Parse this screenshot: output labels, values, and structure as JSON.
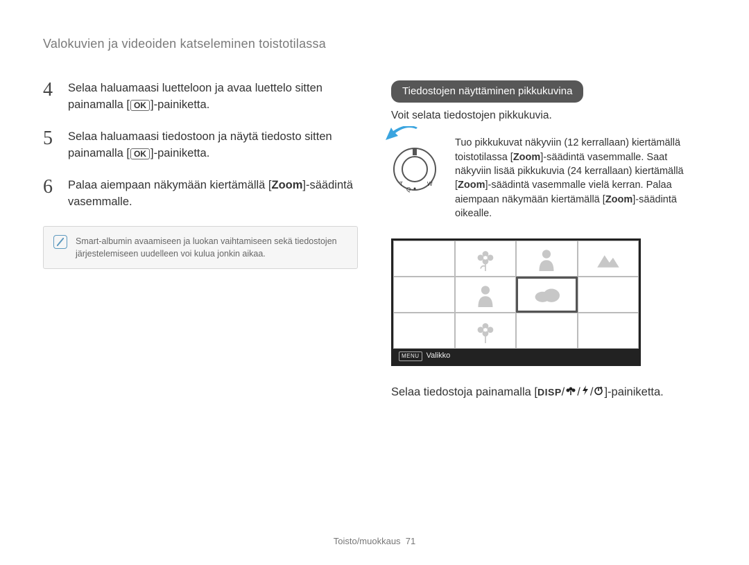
{
  "header": {
    "title": "Valokuvien ja videoiden katseleminen toistotilassa"
  },
  "steps": [
    {
      "num": "4",
      "pre": "Selaa haluamaasi luetteloon ja avaa luettelo sitten painamalla [",
      "ok": "OK",
      "post": "]-painiketta."
    },
    {
      "num": "5",
      "pre": "Selaa haluamaasi tiedostoon ja näytä tiedosto sitten painamalla [",
      "ok": "OK",
      "post": "]-painiketta."
    },
    {
      "num": "6",
      "pre": "Palaa aiempaan näkymään kiertämällä [",
      "bold": "Zoom",
      "post": "]-säädintä vasemmalle."
    }
  ],
  "note": {
    "text": "Smart-albumin avaamiseen ja luokan vaihtamiseen sekä tiedostojen järjestelemiseen uudelleen voi kulua jonkin aikaa."
  },
  "right": {
    "badge": "Tiedostojen näyttäminen pikkukuvina",
    "intro": "Voit selata tiedostojen pikkukuvia.",
    "dial_text": {
      "t1": "Tuo pikkukuvat näkyviin (12 kerrallaan) kiertämällä toistotilassa [",
      "z1": "Zoom",
      "t2": "]-säädintä vasemmalle. Saat näkyviin lisää pikkukuvia (24 kerrallaan) kiertämällä [",
      "z2": "Zoom",
      "t3": "]-säädintä vasemmalle vielä kerran. Palaa aiempaan näkymään kiertämällä [",
      "z3": "Zoom",
      "t4": "]-säädintä oikealle."
    },
    "screen": {
      "menu_label": "MENU",
      "menu_text": "Valikko"
    },
    "scroll": {
      "pre": "Selaa tiedostoja painamalla [",
      "disp": "DISP",
      "post": "]-painiketta."
    }
  },
  "footer": {
    "section": "Toisto/muokkaus",
    "page": "71"
  }
}
